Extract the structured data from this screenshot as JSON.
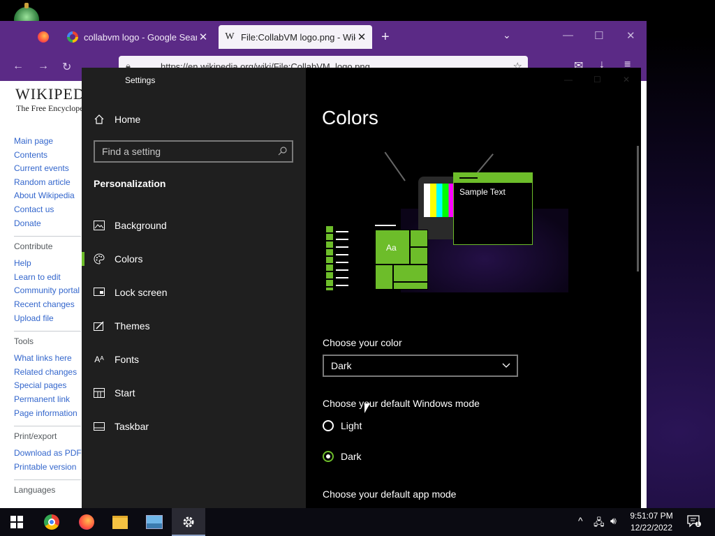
{
  "browser": {
    "tabs": [
      {
        "label": "collabvm logo - Google Search"
      },
      {
        "label": "File:CollabVM logo.png - Wikip"
      }
    ],
    "url": "https://en.wikipedia.org/wiki/File:CollabVM_logo.png"
  },
  "wiki": {
    "logo": "WIKIPEDIA",
    "tagline": "The Free Encyclopedia",
    "nav_links": [
      "Main page",
      "Contents",
      "Current events",
      "Random article",
      "About Wikipedia",
      "Contact us",
      "Donate"
    ],
    "contribute_heading": "Contribute",
    "contribute_links": [
      "Help",
      "Learn to edit",
      "Community portal",
      "Recent changes",
      "Upload file"
    ],
    "tools_heading": "Tools",
    "tools_links": [
      "What links here",
      "Related changes",
      "Special pages",
      "Permanent link",
      "Page information"
    ],
    "print_heading": "Print/export",
    "print_links": [
      "Download as PDF",
      "Printable version"
    ],
    "languages_heading": "Languages"
  },
  "settings": {
    "window_title": "Settings",
    "home": "Home",
    "search_placeholder": "Find a setting",
    "section": "Personalization",
    "nav": [
      {
        "label": "Background",
        "icon": "image-icon"
      },
      {
        "label": "Colors",
        "icon": "palette-icon",
        "active": true
      },
      {
        "label": "Lock screen",
        "icon": "lock-screen-icon"
      },
      {
        "label": "Themes",
        "icon": "themes-icon"
      },
      {
        "label": "Fonts",
        "icon": "fonts-icon"
      },
      {
        "label": "Start",
        "icon": "start-icon"
      },
      {
        "label": "Taskbar",
        "icon": "taskbar-icon"
      }
    ],
    "page_title": "Colors",
    "preview_sample_text": "Sample Text",
    "preview_tile_text": "Aa",
    "choose_color_label": "Choose your color",
    "choose_color_value": "Dark",
    "windows_mode_label": "Choose your default Windows mode",
    "windows_mode_options": [
      "Light",
      "Dark"
    ],
    "windows_mode_selected": "Dark",
    "app_mode_label": "Choose your default app mode",
    "accent_color": "#6dbd2a"
  },
  "taskbar": {
    "apps": [
      "Start",
      "Google Chrome",
      "Firefox",
      "File Explorer",
      "Photos",
      "Settings"
    ],
    "active_app": "Settings",
    "time": "9:51:07 PM",
    "date": "12/22/2022",
    "notification_count": "1"
  }
}
